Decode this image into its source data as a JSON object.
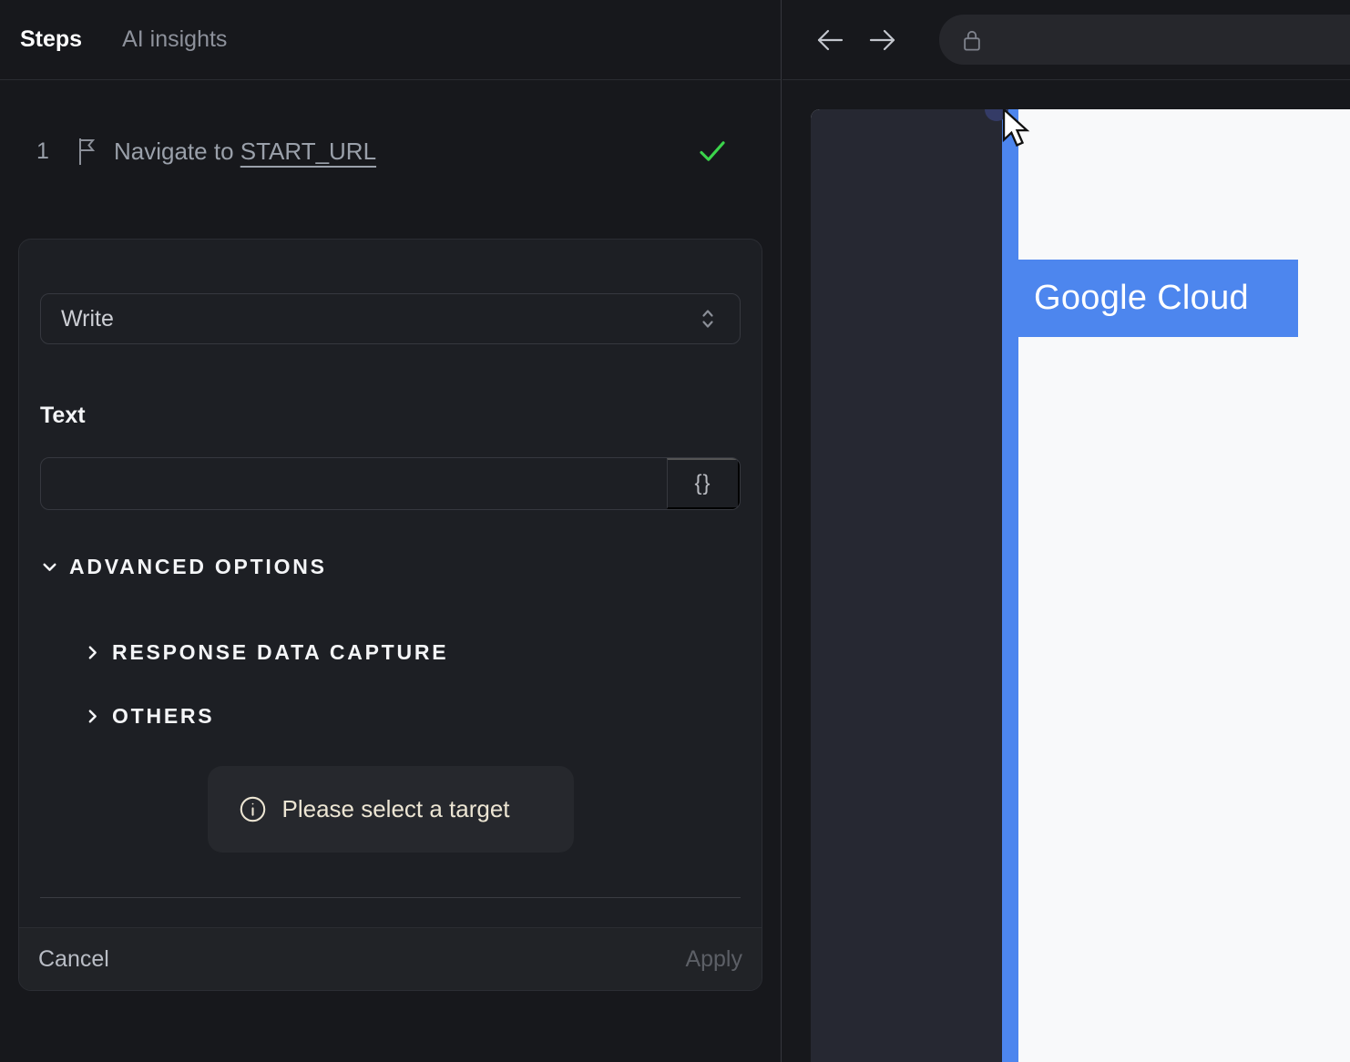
{
  "colors": {
    "accent_blue": "#4d86ee",
    "success_green": "#3bd44b",
    "toast_text": "#ece5d3",
    "page_white": "#f8f9fa"
  },
  "tabs": {
    "steps": "Steps",
    "ai_insights": "AI insights"
  },
  "step": {
    "number": "1",
    "title_prefix": "Navigate to ",
    "link_text": "START_URL"
  },
  "editor": {
    "action_select_value": "Write",
    "text_label": "Text",
    "text_value": "",
    "advanced_options_label": "ADVANCED OPTIONS",
    "response_data_capture_label": "RESPONSE DATA CAPTURE",
    "others_label": "OTHERS",
    "toast_message": "Please select a target",
    "cancel_label": "Cancel",
    "apply_label": "Apply"
  },
  "browser": {
    "highlighted_element_text": "Google Cloud"
  },
  "icons": {
    "flag": "flag-outline",
    "step_check": "green-checkmark",
    "select_chevrons": "up-down-chevrons",
    "braces": "{}",
    "advanced_chevron": "chevron-down",
    "section_chevron": "chevron-right",
    "info": "info-circle",
    "back": "arrow-left",
    "forward": "arrow-right",
    "lock": "padlock",
    "cursor": "arrow-cursor",
    "picker_dot": "selection-handle-dot"
  }
}
